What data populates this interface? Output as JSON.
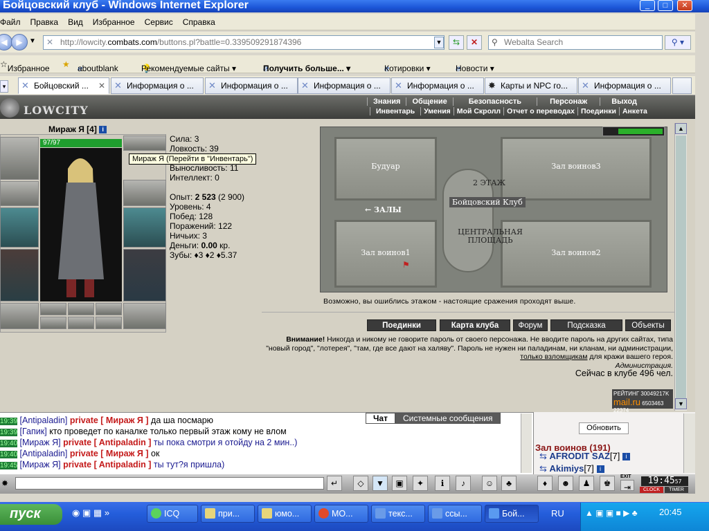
{
  "window": {
    "title": "Бойцовский клуб - Windows Internet Explorer"
  },
  "menu": [
    "Файл",
    "Правка",
    "Вид",
    "Избранное",
    "Сервис",
    "Справка"
  ],
  "address": {
    "url_prefix": "http://lowcity.",
    "url_domain": "combats.com",
    "url_path": "/buttons.pl?battle=0.339509291874396",
    "search_placeholder": "Webalta Search"
  },
  "favorites": {
    "favorites_label": "Избранное",
    "items": [
      "aboutblank",
      "Рекомендуемые сайты ▾",
      "Получить больше... ▾",
      "Котировки ▾",
      "Новости ▾"
    ]
  },
  "tabs": [
    {
      "label": "Бойцовский ...",
      "active": true
    },
    {
      "label": "Информация о ..."
    },
    {
      "label": "Информация о ..."
    },
    {
      "label": "Информация о ..."
    },
    {
      "label": "Информация о ..."
    },
    {
      "label": "Карты и NPC го..."
    },
    {
      "label": "Информация о ..."
    }
  ],
  "game": {
    "logo": "LOWCITY",
    "menu_top": [
      "Знания",
      "Общение",
      "Безопасность",
      "Персонаж",
      "Выход"
    ],
    "menu_bottom": [
      "Инвентарь",
      "Умения",
      "Мой Скролл",
      "Отчет о переводах",
      "Поединки",
      "Анкета"
    ],
    "char_name": "Мираж Я [4]",
    "hp": "97/97",
    "tooltip": "Мираж Я (Перейти в \"Инвентарь\")",
    "stats": {
      "sila": "Сила: 3",
      "lovkost": "Ловкость: 39",
      "vynoslivost": "Выносливость: 11",
      "intellekt": "Интеллект: 0"
    },
    "progress": {
      "opyt_label": "Опыт:",
      "opyt_value": "2 523",
      "opyt_next": "(2 900)",
      "uroven": "Уровень: 4",
      "pobed": "Побед: 128",
      "porazheniy": "Поражений: 122",
      "nichyih": "Ничьих: 3",
      "dengi_label": "Деньги:",
      "dengi_value": "0.00",
      "dengi_unit": "кр.",
      "zuby": "Зубы: ♦3 ♦2 ♦5.37"
    },
    "map": {
      "boudoir": "Будуар",
      "hall3": "Зал воинов3",
      "floor": "2 ЭТАЖ",
      "club": "Бойцовский Клуб",
      "halls": "← ЗАЛЫ",
      "central": "ЦЕНТРАЛЬНАЯ ПЛОЩАДЬ",
      "hall1": "Зал воинов1",
      "hall2": "Зал воинов2"
    },
    "map_hint": "Возможно, вы ошиблись этажом - настоящие сражения проходят выше.",
    "buttons": [
      "Поединки",
      "Карта клуба",
      "Форум",
      "Подсказка",
      "Объекты"
    ],
    "warning_bold": "Внимание!",
    "warning_text": "Никогда и никому не говорите пароль от своего персонажа. Не вводите пароль на других сайтах, типа \"новый город\", \"лотерея\", \"там, где все дают на халяву\". Пароль не нужен ни паладинам, ни кланам, ни администрации,",
    "warning_link": "только взломщикам",
    "warning_tail": "для кражи вашего героя.",
    "admin": "Администрация.",
    "online": "Сейчас в клубе 496 чел.",
    "rating_label": "РЕЙТИНГ",
    "rating_num": "30049217K",
    "mail_counts": "6503463 22374"
  },
  "chat": {
    "tabs": [
      "Чат",
      "Системные сообщения"
    ],
    "lines": [
      {
        "time": "19:39",
        "name": "[Antipaladin]",
        "private": "private [ Мираж Я ]",
        "text": "да ша посмарю"
      },
      {
        "time": "19:39",
        "name": "[Гапик]",
        "private": "",
        "text": "кто проведет по каналке только первый этаж кому не влом"
      },
      {
        "time": "19:40",
        "name": "[Мираж Я]",
        "private": "private [ Antipaladin ]",
        "text": "ты пока смотри я отойду на 2 мин..)"
      },
      {
        "time": "19:40",
        "name": "[Antipaladin]",
        "private": "private [ Мираж Я ]",
        "text": "ок"
      },
      {
        "time": "19:45",
        "name": "[Мираж Я]",
        "private": "private [ Antipaladin ]",
        "text": "ты тут?я пришла)"
      }
    ],
    "refresh": "Обновить",
    "room": "Зал воинов (191)",
    "users": [
      {
        "name": "AFRODIT SAZ",
        "level": "[7]"
      },
      {
        "name": "Akimiys",
        "level": "[7]"
      }
    ],
    "clock": "19:45",
    "clock_sec": "57",
    "clock_label": "CLOCK",
    "timer_label": "TIMER",
    "exit_label": "EXIT"
  },
  "taskbar": {
    "start": "пуск",
    "items": [
      "ICQ",
      "при...",
      "юмо...",
      "МО...",
      "текс...",
      "ссы...",
      "Бой..."
    ],
    "lang": "RU",
    "time": "20:45"
  }
}
